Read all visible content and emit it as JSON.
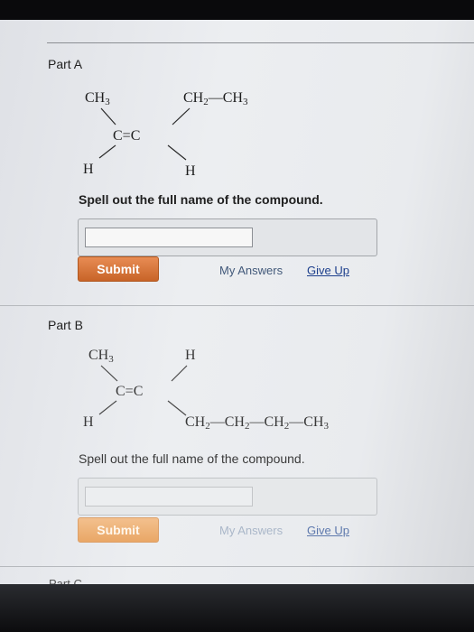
{
  "part_a": {
    "title": "Part A",
    "structure": {
      "top_left": "CH3",
      "top_right": "CH2—CH3",
      "center": "C=C",
      "bottom_left": "H",
      "bottom_right": "H"
    },
    "question": "Spell out the full name of the compound.",
    "answer_value": "",
    "submit_label": "Submit",
    "my_answers_label": "My Answers",
    "give_up_label": "Give Up"
  },
  "part_b": {
    "title": "Part B",
    "structure": {
      "top_left": "CH3",
      "top_right": "H",
      "center": "C=C",
      "bottom_left": "H",
      "bottom_right": "CH2—CH2—CH2—CH3"
    },
    "question": "Spell out the full name of the compound.",
    "answer_value": "",
    "submit_label": "Submit",
    "my_answers_label": "My Answers",
    "give_up_label": "Give Up"
  },
  "part_c": {
    "title": "Part C"
  },
  "colors": {
    "submit_orange": "#d8763a",
    "link_blue": "#1d3f8c",
    "page_bg": "#e9ebee"
  }
}
